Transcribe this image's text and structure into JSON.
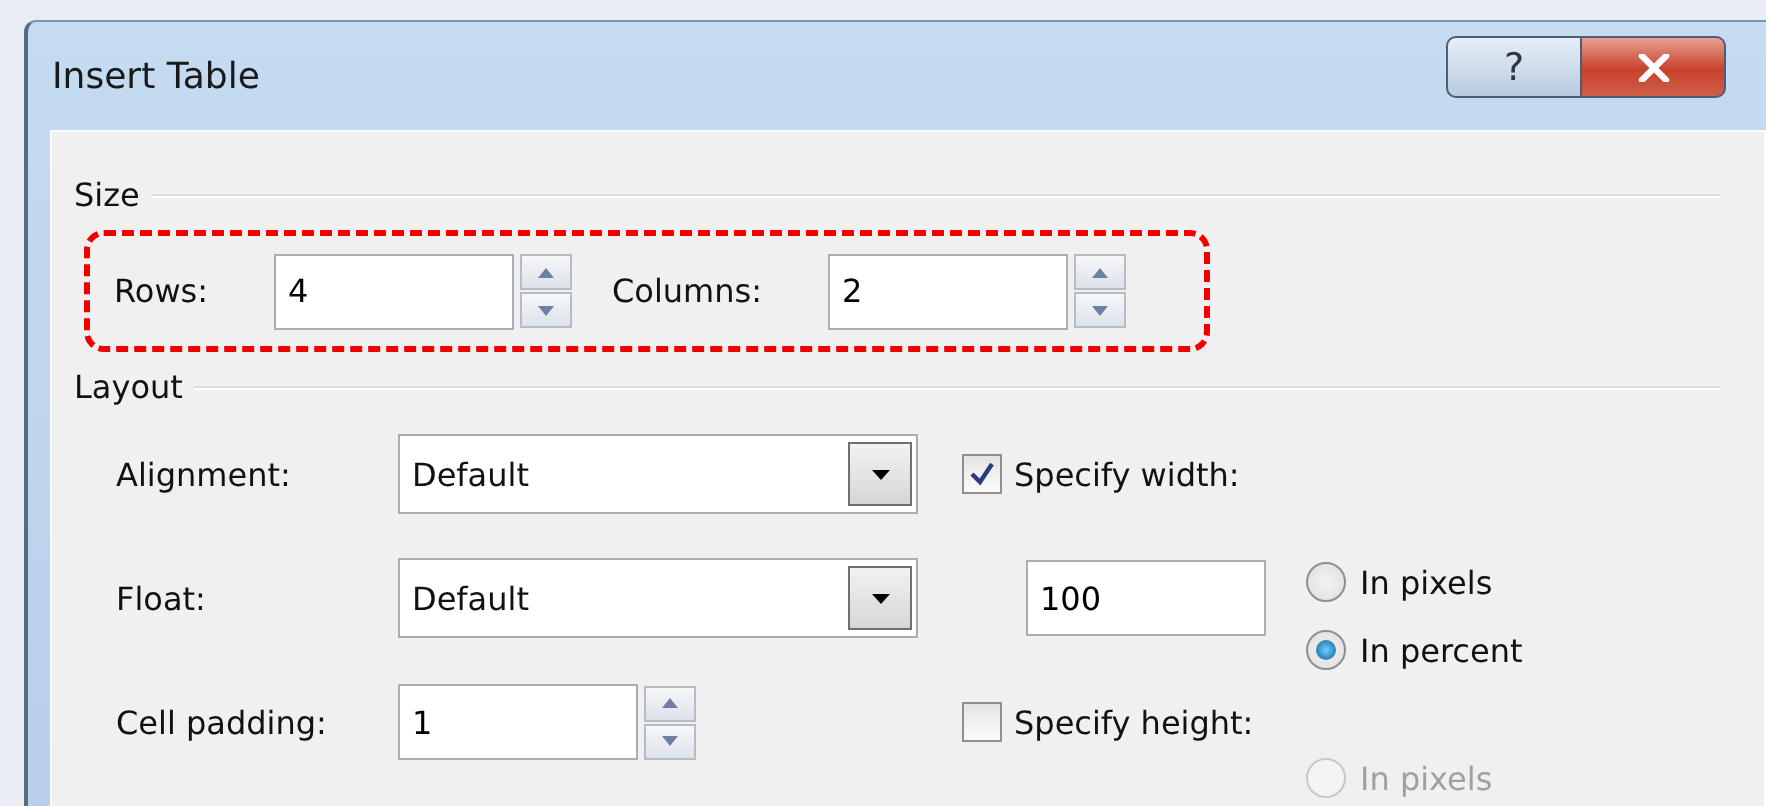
{
  "window": {
    "title": "Insert Table"
  },
  "title_buttons": [
    {
      "kind": "help",
      "label": "?"
    },
    {
      "kind": "close"
    }
  ],
  "size": {
    "title": "Size",
    "highlighted": true,
    "fields": [
      {
        "label": "Rows:",
        "value": "4"
      },
      {
        "label": "Columns:",
        "value": "2"
      }
    ]
  },
  "layout": {
    "title": "Layout",
    "alignment": {
      "label": "Alignment:",
      "value": "Default"
    },
    "float": {
      "label": "Float:",
      "value": "Default"
    },
    "cell_padding": {
      "label": "Cell padding:",
      "value": "1"
    },
    "specify_width": {
      "label": "Specify width:",
      "checked": true,
      "value": "100",
      "units": [
        {
          "label": "In pixels",
          "selected": false,
          "disabled": false
        },
        {
          "label": "In percent",
          "selected": true,
          "disabled": false
        }
      ]
    },
    "specify_height": {
      "label": "Specify height:",
      "checked": false,
      "units": [
        {
          "label": "In pixels",
          "selected": false,
          "disabled": true
        }
      ]
    }
  }
}
